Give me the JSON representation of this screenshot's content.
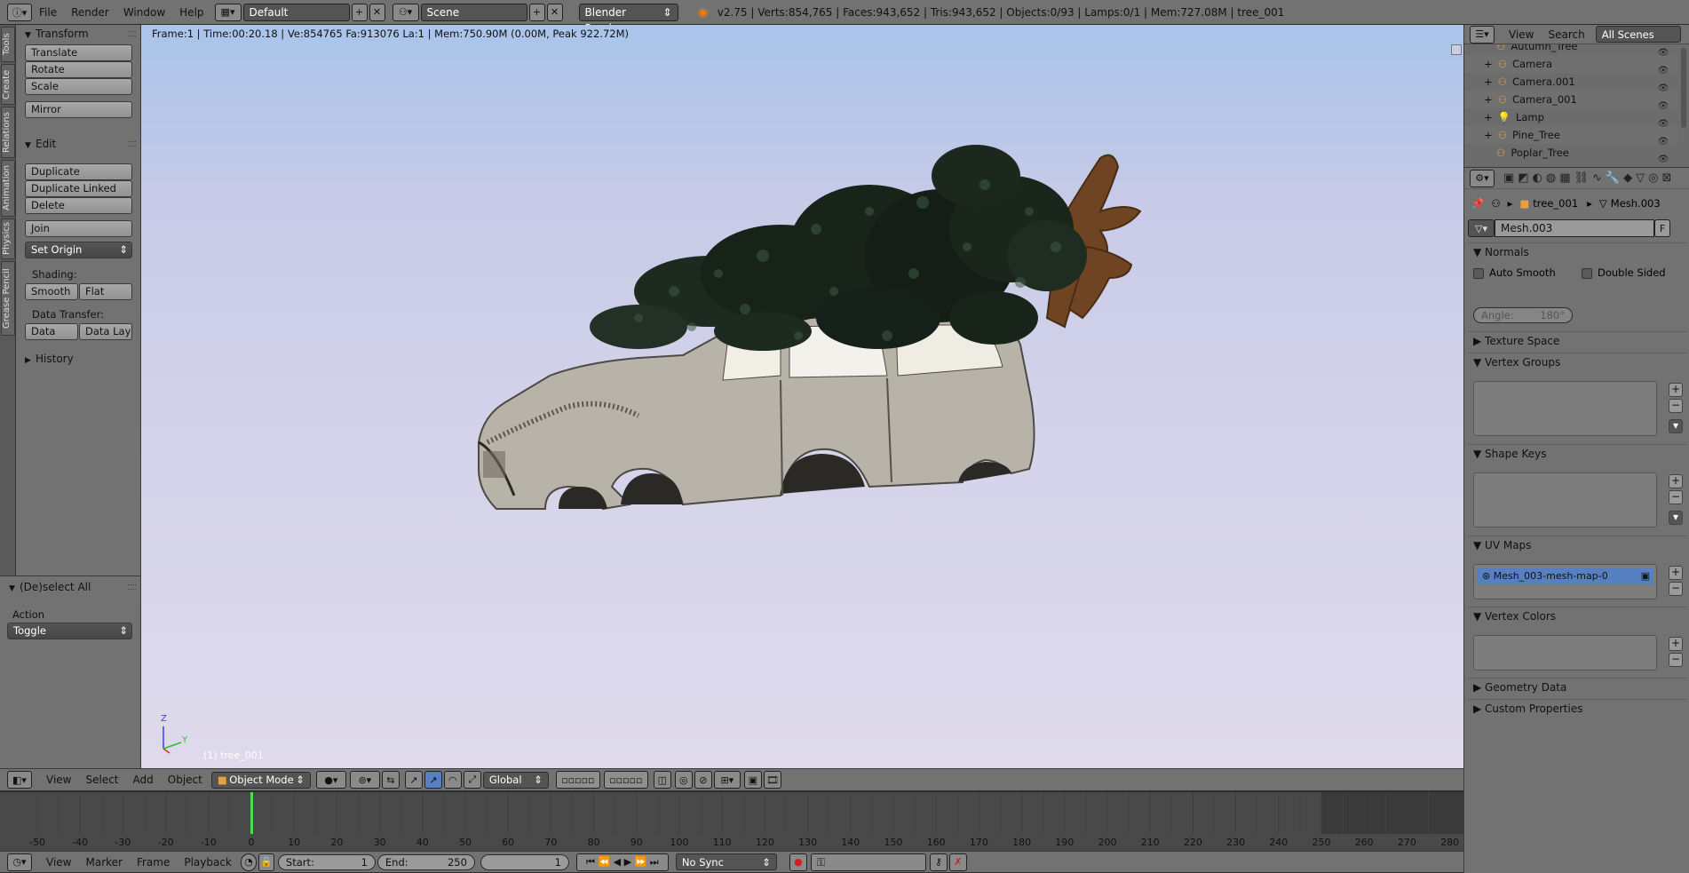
{
  "topbar": {
    "menus": [
      "File",
      "Render",
      "Window",
      "Help"
    ],
    "screen_layout": "Default",
    "scene": "Scene",
    "engine": "Blender Render",
    "stats": "v2.75 | Verts:854,765 | Faces:943,652 | Tris:943,652 | Objects:0/93 | Lamps:0/1 | Mem:727.08M | tree_001"
  },
  "toolshelf": {
    "tabs": [
      "Tools",
      "Create",
      "Relations",
      "Animation",
      "Physics",
      "Grease Pencil"
    ],
    "transform": {
      "title": "Transform",
      "buttons": [
        "Translate",
        "Rotate",
        "Scale",
        "Mirror"
      ]
    },
    "edit": {
      "title": "Edit",
      "buttons": [
        "Duplicate",
        "Duplicate Linked",
        "Delete",
        "Join"
      ],
      "set_origin": "Set Origin"
    },
    "shading": {
      "label": "Shading:",
      "smooth": "Smooth",
      "flat": "Flat"
    },
    "data_transfer": {
      "label": "Data Transfer:",
      "data": "Data",
      "data_layout": "Data Layo"
    },
    "history": {
      "title": "History"
    }
  },
  "operator": {
    "title": "(De)select All",
    "action_label": "Action",
    "action_value": "Toggle"
  },
  "viewport": {
    "info": "Frame:1 | Time:00:20.18 | Ve:854765 Fa:913076 La:1 | Mem:750.90M (0.00M, Peak 922.72M)",
    "object_label": "(1) tree_001",
    "axis_z": "Z",
    "axis_y": "Y"
  },
  "view3d_header": {
    "menus": [
      "View",
      "Select",
      "Add",
      "Object"
    ],
    "mode": "Object Mode",
    "orientation": "Global"
  },
  "timeline": {
    "ticks": [
      "-50",
      "-40",
      "-30",
      "-20",
      "-10",
      "0",
      "10",
      "20",
      "30",
      "40",
      "50",
      "60",
      "70",
      "80",
      "90",
      "100",
      "110",
      "120",
      "130",
      "140",
      "150",
      "160",
      "170",
      "180",
      "190",
      "200",
      "210",
      "220",
      "230",
      "240",
      "250",
      "260",
      "270",
      "280"
    ],
    "current_frame_marker": 0,
    "menus": [
      "View",
      "Marker",
      "Frame",
      "Playback"
    ],
    "start_label": "Start:",
    "start_value": "1",
    "end_label": "End:",
    "end_value": "250",
    "current": "1",
    "sync": "No Sync"
  },
  "outliner": {
    "menus": [
      "View",
      "Search"
    ],
    "scope": "All Scenes",
    "items": [
      "Autumn_Tree",
      "Camera",
      "Camera.001",
      "Camera_001",
      "Lamp",
      "Pine_Tree",
      "Poplar_Tree"
    ]
  },
  "properties": {
    "breadcrumb_object": "tree_001",
    "breadcrumb_mesh": "Mesh.003",
    "mesh_name": "Mesh.003",
    "fake_user": "F",
    "normals": {
      "title": "Normals",
      "auto_smooth": "Auto Smooth",
      "double_sided": "Double Sided",
      "angle": "Angle:",
      "angle_value": "180°"
    },
    "texture_space": "Texture Space",
    "vertex_groups": "Vertex Groups",
    "shape_keys": "Shape Keys",
    "uv_maps": {
      "title": "UV Maps",
      "item": "Mesh_003-mesh-map-0"
    },
    "vertex_colors": "Vertex Colors",
    "geometry_data": "Geometry Data",
    "custom_properties": "Custom Properties"
  }
}
